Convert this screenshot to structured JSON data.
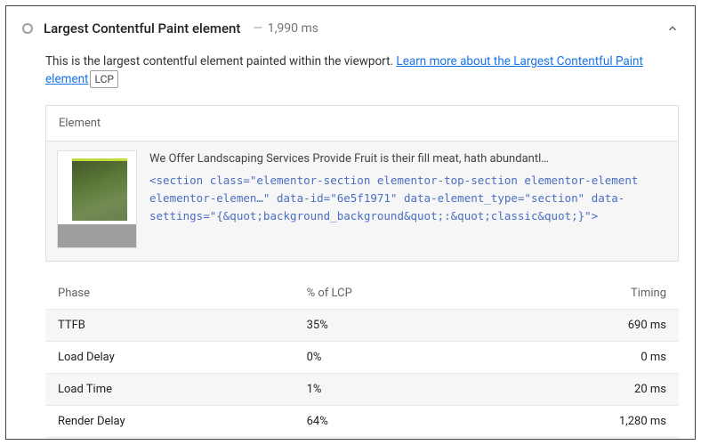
{
  "header": {
    "title": "Largest Contentful Paint element",
    "timing": "1,990 ms"
  },
  "description": {
    "text_before_link": "This is the largest contentful element painted within the viewport. ",
    "link_text": "Learn more about the Largest Contentful Paint element",
    "tag": "LCP"
  },
  "element_panel": {
    "heading": "Element",
    "snippet_text": "We Offer Landscaping Services Provide Fruit is their fill meat, hath abundantl…",
    "code_html": "<section class=\"elementor-section elementor-top-section elementor-element elementor-elemen…\" data-id=\"6e5f1971\" data-element_type=\"section\" data-settings=\"{&quot;background_background&quot;:&quot;classic&quot;}\">"
  },
  "phase_table": {
    "headers": {
      "phase": "Phase",
      "pct": "% of LCP",
      "timing": "Timing"
    },
    "rows": [
      {
        "phase": "TTFB",
        "pct": "35%",
        "timing": "690 ms"
      },
      {
        "phase": "Load Delay",
        "pct": "0%",
        "timing": "0 ms"
      },
      {
        "phase": "Load Time",
        "pct": "1%",
        "timing": "20 ms"
      },
      {
        "phase": "Render Delay",
        "pct": "64%",
        "timing": "1,280 ms"
      }
    ]
  }
}
